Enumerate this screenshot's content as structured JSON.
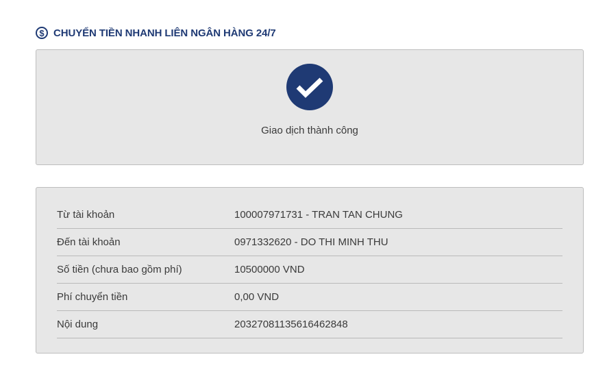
{
  "header": {
    "icon": "dollar-circle-icon",
    "title": "CHUYỂN TIỀN NHANH LIÊN NGÂN HÀNG 24/7"
  },
  "status": {
    "icon": "check-circle-icon",
    "text": "Giao dịch thành công"
  },
  "details": {
    "rows": [
      {
        "label": "Từ tài khoản",
        "value": "100007971731 - TRAN TAN CHUNG"
      },
      {
        "label": "Đến tài khoản",
        "value": "0971332620 - DO THI MINH THU"
      },
      {
        "label": "Số tiền (chưa bao gồm phí)",
        "value": "10500000 VND"
      },
      {
        "label": "Phí chuyển tiền",
        "value": "0,00 VND"
      },
      {
        "label": "Nội dung",
        "value": "20327081135616462848"
      }
    ]
  },
  "colors": {
    "brand": "#1f3a74",
    "panel_bg": "#e7e7e7"
  }
}
